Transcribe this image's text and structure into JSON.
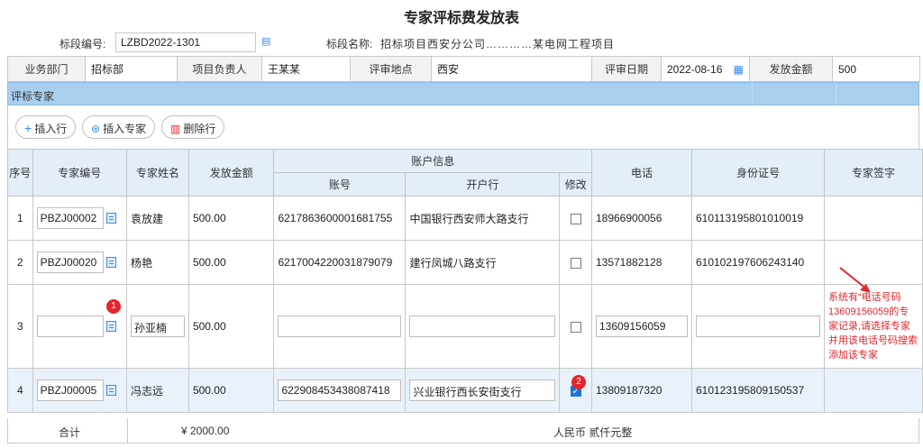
{
  "title": "专家评标费发放表",
  "meta": {
    "section_code_label": "标段编号:",
    "section_code_value": "LZBD2022-1301",
    "section_name_label": "标段名称:",
    "section_name_value": "招标项目西安分公司…………某电网工程项目"
  },
  "info": {
    "dept_label": "业务部门",
    "dept_value": "招标部",
    "owner_label": "项目负责人",
    "owner_value": "王某某",
    "place_label": "评审地点",
    "place_value": "西安",
    "date_label": "评审日期",
    "date_value": "2022-08-16",
    "amount_label": "发放金额",
    "amount_value": "500"
  },
  "section_title": "评标专家",
  "toolbar": {
    "insert_row": "插入行",
    "insert_expert": "插入专家",
    "delete_row": "删除行"
  },
  "columns": {
    "seq": "序号",
    "expert_code": "专家编号",
    "expert_name": "专家姓名",
    "amount": "发放金额",
    "account_info": "账户信息",
    "account_no": "账号",
    "bank": "开户行",
    "modify": "修改",
    "phone": "电话",
    "id_no": "身份证号",
    "signature": "专家签字"
  },
  "rows": [
    {
      "seq": "1",
      "code": "PBZJ00002",
      "name": "袁放建",
      "amount": "500.00",
      "account": "6217863600001681755",
      "bank": "中国银行西安师大路支行",
      "phone": "18966900056",
      "id_no": "610113195801010019"
    },
    {
      "seq": "2",
      "code": "PBZJ00020",
      "name": "杨艳",
      "amount": "500.00",
      "account": "6217004220031879079",
      "bank": "建行凤城八路支行",
      "phone": "13571882128",
      "id_no": "610102197606243140"
    },
    {
      "seq": "3",
      "code": "",
      "name": "孙亚楠",
      "amount": "500.00",
      "account": "",
      "bank": "",
      "phone": "13609156059",
      "id_no": ""
    },
    {
      "seq": "4",
      "code": "PBZJ00005",
      "name": "冯志远",
      "amount": "500.00",
      "account": "622908453438087418",
      "bank": "兴业银行西长安街支行",
      "phone": "13809187320",
      "id_no": "610123195809150537"
    }
  ],
  "annotations": {
    "badge1": "1",
    "badge2": "2",
    "note": "系统有“电话号码13609156059的专家记录,请选择专家并用该电话号码搜索添加该专家"
  },
  "total": {
    "label": "合计",
    "amount": "¥ 2000.00",
    "words": "人民币 贰仟元整"
  },
  "colors": {
    "section_bar": "#a8cfee",
    "header_bg": "#e3eef9",
    "highlight_row": "#e9f1fb",
    "annotation_red": "#e3262b",
    "check_blue": "#1e74d8"
  }
}
